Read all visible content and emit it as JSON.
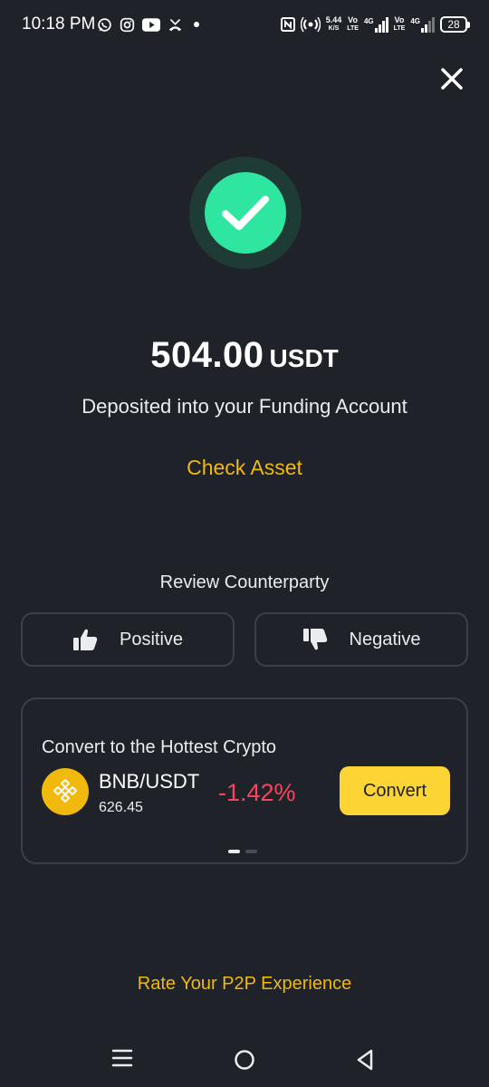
{
  "status_bar": {
    "time": "10:18 PM",
    "left_icons": [
      "whatsapp-icon",
      "instagram-icon",
      "youtube-icon",
      "missed-call-icon",
      "dot-icon"
    ],
    "speed_value": "5.44",
    "speed_unit": "K/S",
    "sim1_top": "Vo",
    "sim1_bottom": "LTE",
    "sim1_net": "4G",
    "sim2_top": "Vo",
    "sim2_bottom": "LTE",
    "sim2_net": "4G",
    "battery": "28"
  },
  "deposit": {
    "amount": "504.00",
    "currency": "USDT",
    "message": "Deposited into your Funding Account",
    "check_asset_label": "Check Asset"
  },
  "review": {
    "title": "Review Counterparty",
    "positive_label": "Positive",
    "negative_label": "Negative"
  },
  "convert_card": {
    "heading": "Convert to the Hottest Crypto",
    "pair": "BNB/USDT",
    "price": "626.45",
    "change": "-1.42%",
    "button_label": "Convert",
    "active_page": 1,
    "page_count": 2
  },
  "rate_link": "Rate Your P2P Experience",
  "colors": {
    "background": "#1f2329",
    "accent_yellow": "#f0b90b",
    "button_yellow": "#fcd535",
    "success_green": "#2ee6a0",
    "negative_red": "#f6465d"
  }
}
